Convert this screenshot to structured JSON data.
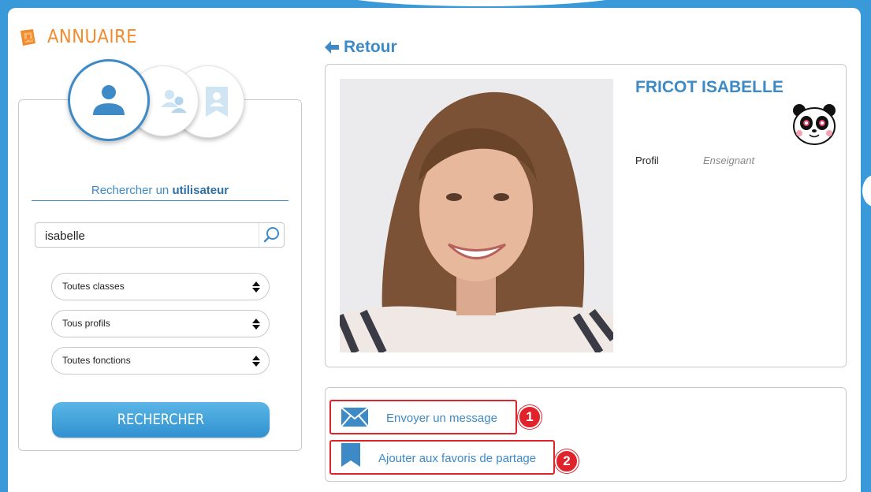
{
  "header": {
    "title": "ANNUAIRE",
    "back_label": "Retour"
  },
  "search": {
    "heading_prefix": "Rechercher un ",
    "heading_bold": "utilisateur",
    "query": "isabelle",
    "selects": [
      {
        "value": "Toutes classes"
      },
      {
        "value": "Tous profils"
      },
      {
        "value": "Toutes fonctions"
      }
    ],
    "button_label": "RECHERCHER"
  },
  "profile": {
    "name": "FRICOT ISABELLE",
    "field_label": "Profil",
    "field_value": "Enseignant"
  },
  "actions": [
    {
      "label": "Envoyer un message",
      "badge": "1",
      "icon": "envelope-icon"
    },
    {
      "label": "Ajouter aux favoris de partage",
      "badge": "2",
      "icon": "bookmark-icon"
    }
  ],
  "colors": {
    "accent_blue": "#3d8ac7",
    "title_orange": "#f28a2e",
    "highlight_red": "#e0222b",
    "background_blue": "#3a9ad9"
  }
}
